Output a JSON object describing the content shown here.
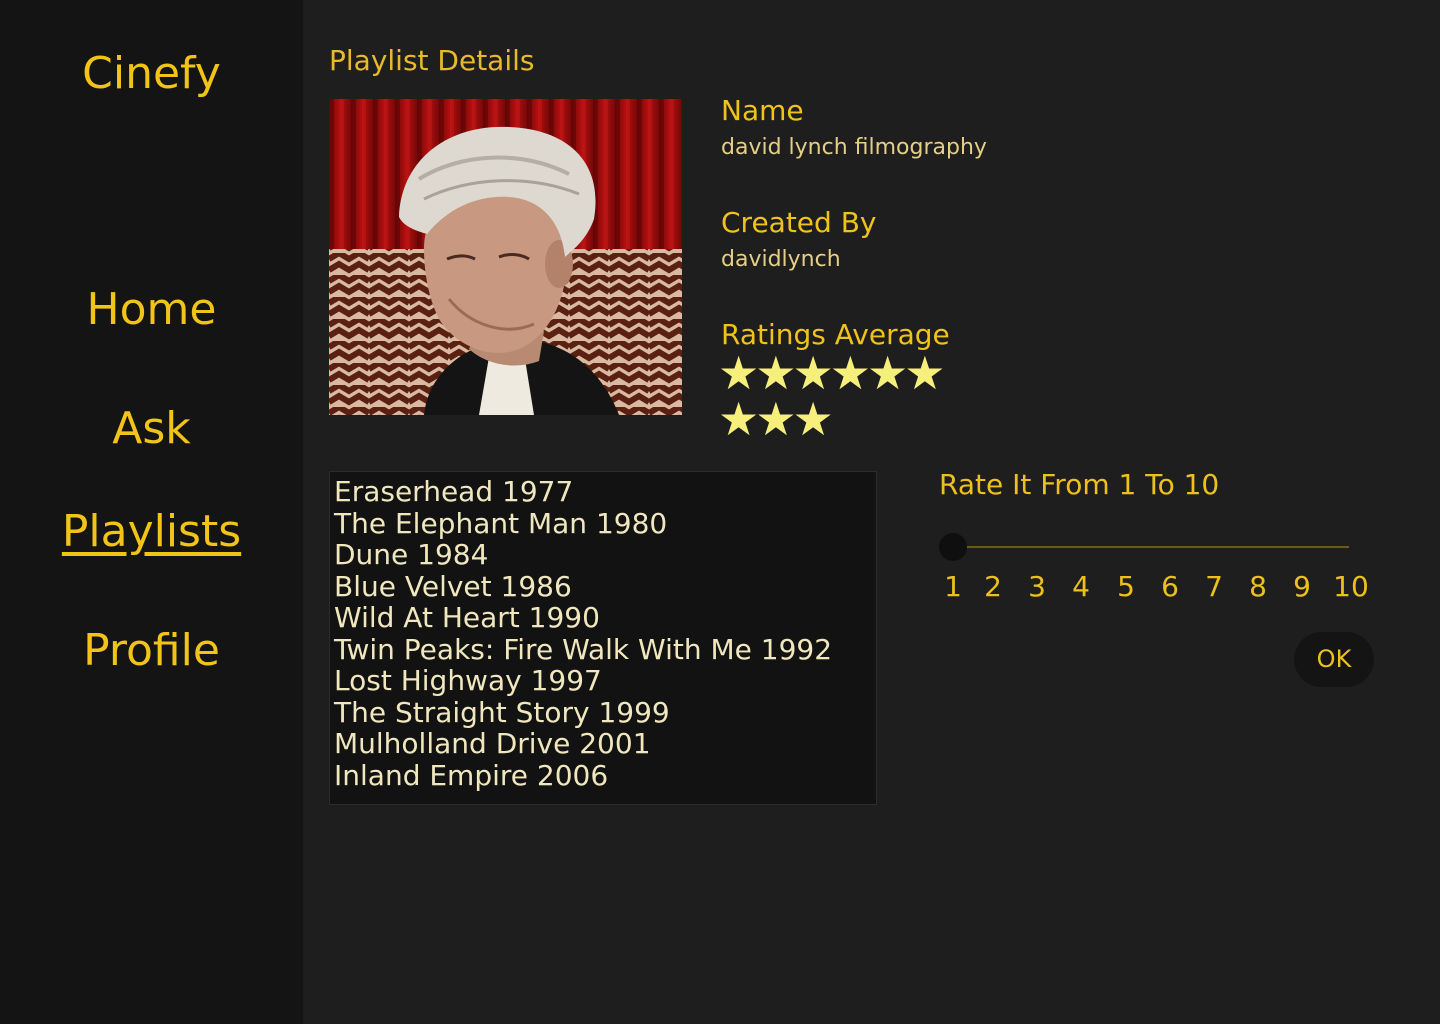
{
  "app": {
    "title": "Cinefy"
  },
  "sidebar": {
    "items": [
      {
        "label": "Home"
      },
      {
        "label": "Ask"
      },
      {
        "label": "Playlists",
        "active": true
      },
      {
        "label": "Profile"
      }
    ]
  },
  "page": {
    "title": "Playlist Details"
  },
  "playlist": {
    "cover_image": "portrait-photo",
    "name_label": "Name",
    "name": "david lynch filmography",
    "created_by_label": "Created By",
    "created_by": "davidlynch",
    "rating_label": "Ratings Average",
    "rating_stars": 9,
    "rating_max": 10,
    "rating_icon": "star-icon",
    "movies": [
      "Eraserhead 1977",
      "The Elephant Man 1980",
      "Dune 1984",
      "Blue Velvet 1986",
      "Wild At Heart 1990",
      "Twin Peaks: Fire Walk With Me 1992",
      "Lost Highway 1997",
      "The Straight Story 1999",
      "Mulholland Drive 2001",
      "Inland Empire 2006"
    ]
  },
  "rating_input": {
    "label": "Rate It From 1 To 10",
    "ticks": [
      "1",
      "2",
      "3",
      "4",
      "5",
      "6",
      "7",
      "8",
      "9",
      "10"
    ],
    "value": 1,
    "ok_label": "OK"
  },
  "colors": {
    "accent": "#f2c418",
    "star": "#f7ef7c",
    "sidebar_bg": "#141414",
    "main_bg": "#1e1e1e"
  }
}
